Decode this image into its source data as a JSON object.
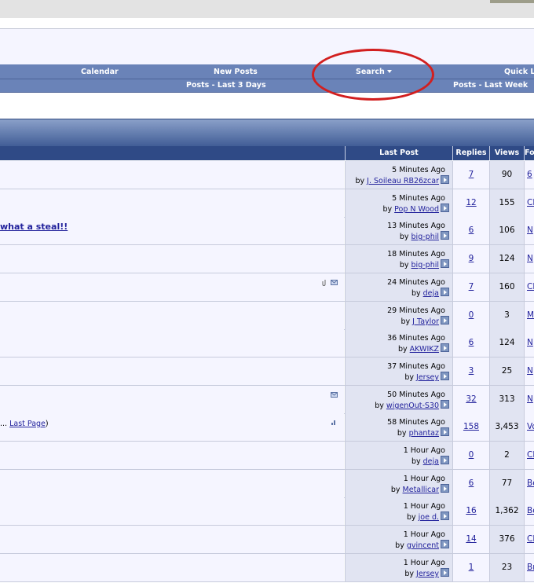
{
  "navbar": {
    "calendar": "Calendar",
    "new_posts": "New Posts",
    "search": "Search",
    "quick_links": "Quick L",
    "posts_last_3_days": "Posts - Last 3 Days",
    "posts_last_week": "Posts - Last Week"
  },
  "table": {
    "headers": {
      "last_post": "Last Post",
      "replies": "Replies",
      "views": "Views",
      "forum": "Fo"
    },
    "by_prefix": "by ",
    "rows": [
      {
        "time": "5 Minutes Ago",
        "user": "J. Soileau RB26zcar",
        "replies": "7",
        "views": "90",
        "forum": "6"
      },
      {
        "time": "5 Minutes Ago",
        "user": "Pop N Wood",
        "replies": "12",
        "views": "155",
        "forum": "Cl"
      },
      {
        "time": "13 Minutes Ago",
        "user": "big-phil",
        "replies": "6",
        "views": "106",
        "forum": "N",
        "title": "what a steal!!"
      },
      {
        "time": "18 Minutes Ago",
        "user": "big-phil",
        "replies": "9",
        "views": "124",
        "forum": "N"
      },
      {
        "time": "24 Minutes Ago",
        "user": "deja",
        "replies": "7",
        "views": "160",
        "forum": "Cl",
        "icons": [
          "paperclip-icon",
          "envelope-icon"
        ]
      },
      {
        "time": "29 Minutes Ago",
        "user": "J Taylor",
        "replies": "0",
        "views": "3",
        "forum": "M"
      },
      {
        "time": "36 Minutes Ago",
        "user": "AKWIKZ",
        "replies": "6",
        "views": "124",
        "forum": "N"
      },
      {
        "time": "37 Minutes Ago",
        "user": "Jersey",
        "replies": "3",
        "views": "25",
        "forum": "N"
      },
      {
        "time": "50 Minutes Ago",
        "user": "wigenOut-S30",
        "replies": "32",
        "views": "313",
        "forum": "N",
        "icons": [
          "envelope-icon"
        ]
      },
      {
        "time": "58 Minutes Ago",
        "user": "phantaz",
        "replies": "158",
        "views": "3,453",
        "forum": "Vo",
        "pages_prefix": "... ",
        "pages_link": "Last Page",
        "pages_suffix": ")",
        "icons": [
          "poll-icon"
        ]
      },
      {
        "time": "1 Hour Ago",
        "user": "deja",
        "replies": "0",
        "views": "2",
        "forum": "Cl"
      },
      {
        "time": "1 Hour Ago",
        "user": "Metallicar",
        "replies": "6",
        "views": "77",
        "forum": "Bo"
      },
      {
        "time": "1 Hour Ago",
        "user": "joe d.",
        "replies": "16",
        "views": "1,362",
        "forum": "Bo"
      },
      {
        "time": "1 Hour Ago",
        "user": "gvincent",
        "replies": "14",
        "views": "376",
        "forum": "Cl"
      },
      {
        "time": "1 Hour Ago",
        "user": "Jersey",
        "replies": "1",
        "views": "23",
        "forum": "Br"
      }
    ]
  },
  "colors": {
    "nav": "#6a83b8",
    "header": "#2f4a86",
    "link": "#22229c",
    "highlight": "#d21f1f"
  }
}
